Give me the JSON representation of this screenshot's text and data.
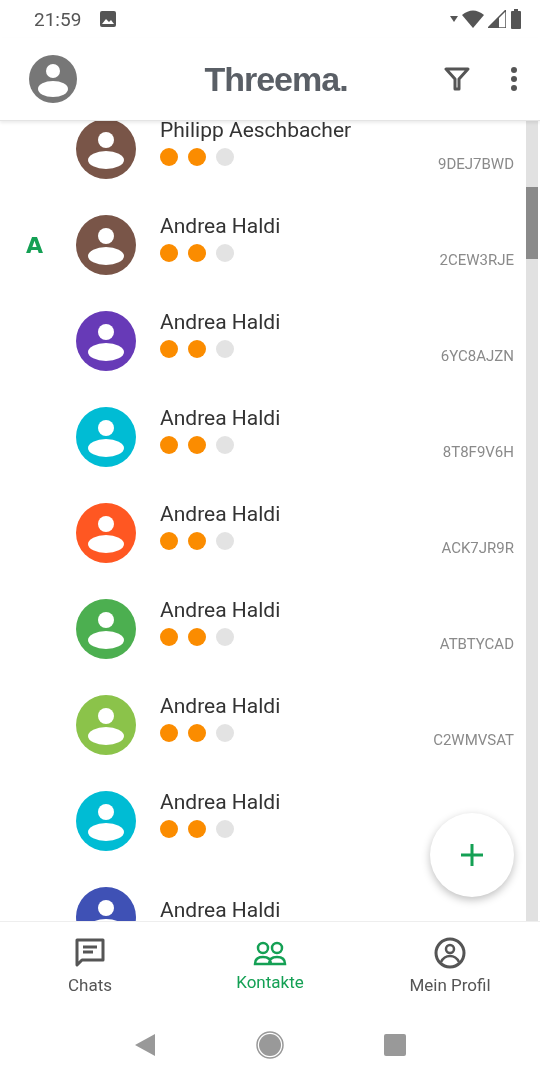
{
  "status_bar": {
    "time": "21:59"
  },
  "app_bar": {
    "title": "Threema."
  },
  "contacts": [
    {
      "name": "Philipp Aeschbacher",
      "id": "9DEJ7BWD",
      "stars": 2,
      "color": "#795548"
    },
    {
      "section": "A",
      "name": "Andrea Haldi",
      "id": "2CEW3RJE",
      "stars": 2,
      "color": "#795548"
    },
    {
      "name": "Andrea Haldi",
      "id": "6YC8AJZN",
      "stars": 2,
      "color": "#673ab7"
    },
    {
      "name": "Andrea Haldi",
      "id": "8T8F9V6H",
      "stars": 2,
      "color": "#00bcd4"
    },
    {
      "name": "Andrea Haldi",
      "id": "ACK7JR9R",
      "stars": 2,
      "color": "#ff5722"
    },
    {
      "name": "Andrea Haldi",
      "id": "ATBTYCAD",
      "stars": 2,
      "color": "#4caf50"
    },
    {
      "name": "Andrea Haldi",
      "id": "C2WMVSAT",
      "stars": 2,
      "color": "#8bc34a"
    },
    {
      "name": "Andrea Haldi",
      "stars": 2,
      "color": "#00bcd4"
    },
    {
      "name": "Andrea Haldi",
      "color": "#3f51b5"
    }
  ],
  "bottom_nav": [
    {
      "kind": "chats",
      "label": "Chats",
      "selected": false
    },
    {
      "kind": "contacts",
      "label": "Kontakte",
      "selected": true
    },
    {
      "kind": "profile",
      "label": "Mein Profil",
      "selected": false
    }
  ]
}
